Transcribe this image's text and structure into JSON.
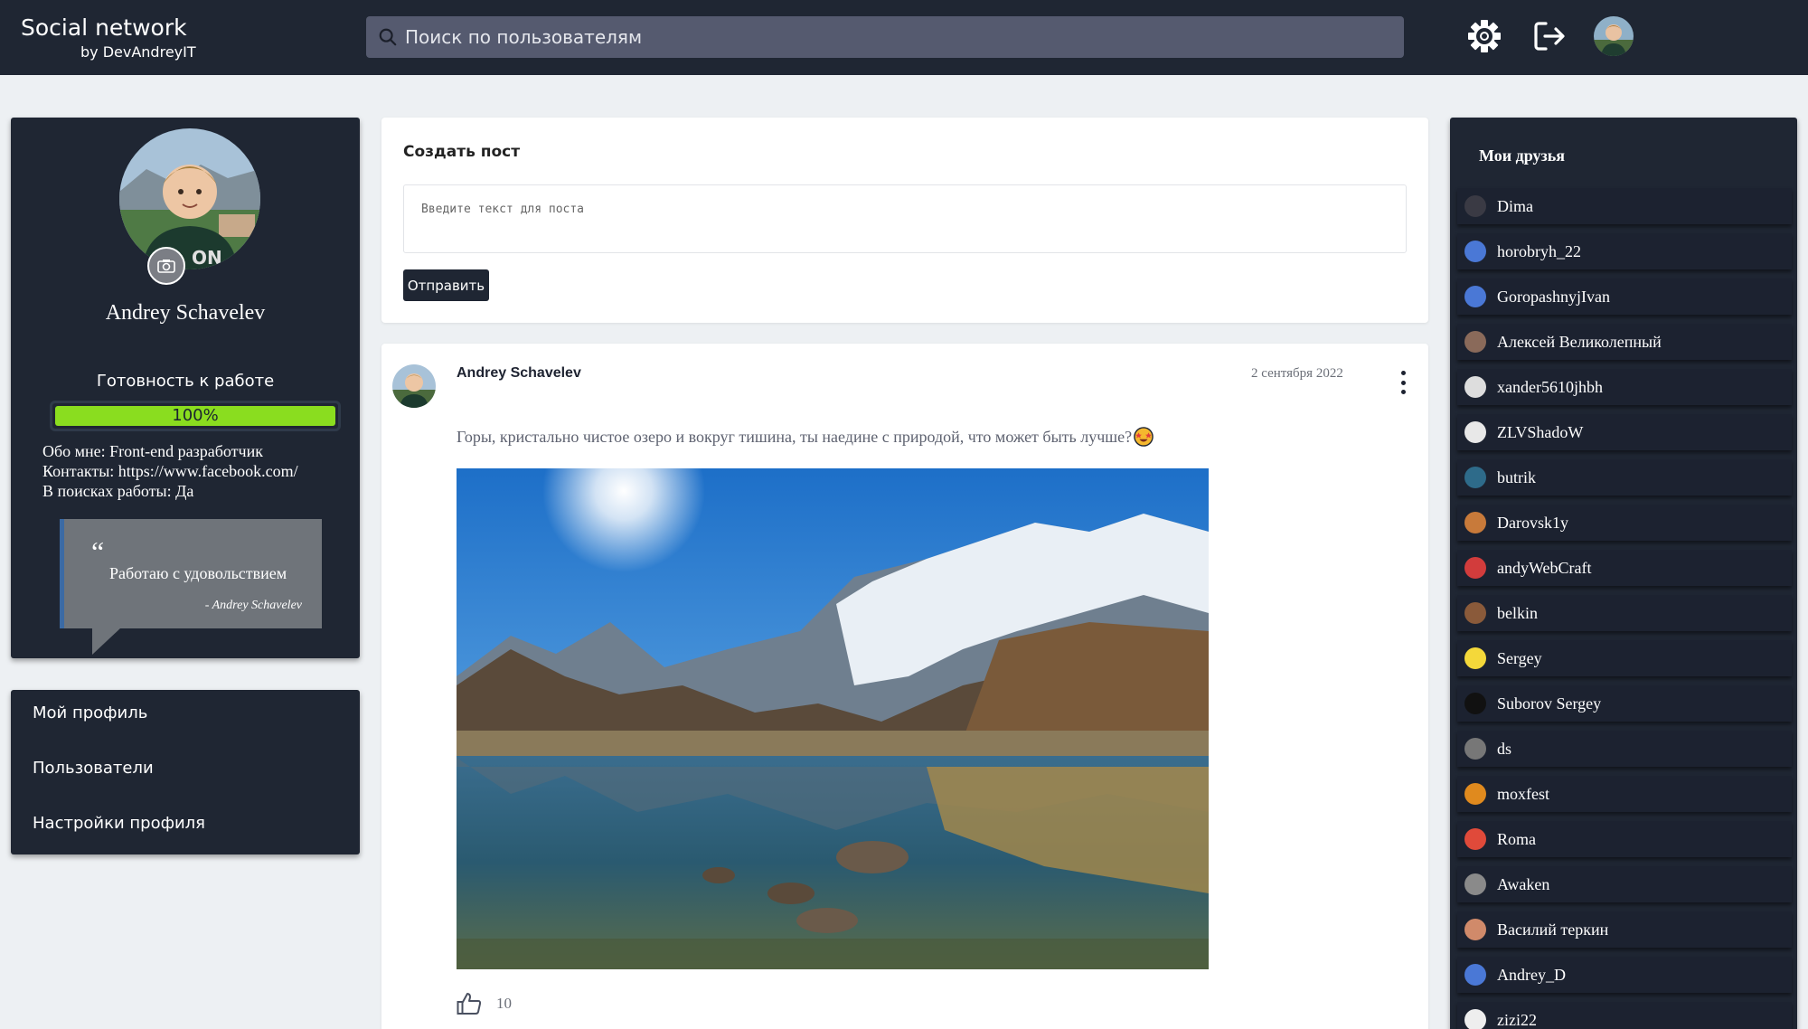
{
  "header": {
    "brand_title": "Social network",
    "brand_sub": "by DevAndreyIT",
    "search_placeholder": "Поиск по пользователям"
  },
  "profile": {
    "name": "Andrey Schavelev",
    "ready_label": "Готовность к работе",
    "ready_progress": 1.0,
    "ready_text": "100%",
    "about_lines": [
      "Обо мне: Front-end разработчик",
      "Контакты: https://www.facebook.com/",
      "В поисках работы: Да"
    ],
    "quote_mark": "“",
    "quote_text": "Работаю с удовольствием",
    "quote_author": "- Andrey Schavelev"
  },
  "nav": {
    "items": [
      "Мой профиль",
      "Пользователи",
      "Настройки профиля"
    ]
  },
  "create_post": {
    "title": "Создать пост",
    "placeholder": "Введите текст для поста",
    "submit_label": "Отправить"
  },
  "post": {
    "author": "Andrey Schavelev",
    "date": "2 сентября 2022",
    "text": "Горы, кристально чистое озеро и вокруг тишина, ты наедине с природой, что может быть лучше?",
    "like_count": "10"
  },
  "friends": {
    "title": "Мои друзья",
    "items": [
      {
        "name": "Dima",
        "color": "#3a3a44"
      },
      {
        "name": "horobryh_22",
        "color": "#4a78d6"
      },
      {
        "name": "GoropashnyjIvan",
        "color": "#4a78d6"
      },
      {
        "name": "Алексей Великолепный",
        "color": "#8a6a5a"
      },
      {
        "name": "xander5610jhbh",
        "color": "#dddddd"
      },
      {
        "name": "ZLVShadoW",
        "color": "#e8e8e8"
      },
      {
        "name": "butrik",
        "color": "#2e6b8a"
      },
      {
        "name": "Darovsk1y",
        "color": "#c87a3a"
      },
      {
        "name": "andyWebCraft",
        "color": "#d23c3c"
      },
      {
        "name": "belkin",
        "color": "#8a5a3a"
      },
      {
        "name": "Sergey",
        "color": "#f4d83a"
      },
      {
        "name": "Suborov Sergey",
        "color": "#111111"
      },
      {
        "name": "ds",
        "color": "#777777"
      },
      {
        "name": "moxfest",
        "color": "#e08a1e"
      },
      {
        "name": "Roma",
        "color": "#e04a3a"
      },
      {
        "name": "Awaken",
        "color": "#8a8a8a"
      },
      {
        "name": "Василий теркин",
        "color": "#d08a6a"
      },
      {
        "name": "Andrey_D",
        "color": "#4a78d6"
      },
      {
        "name": "zizi22",
        "color": "#eeeeee"
      }
    ]
  }
}
